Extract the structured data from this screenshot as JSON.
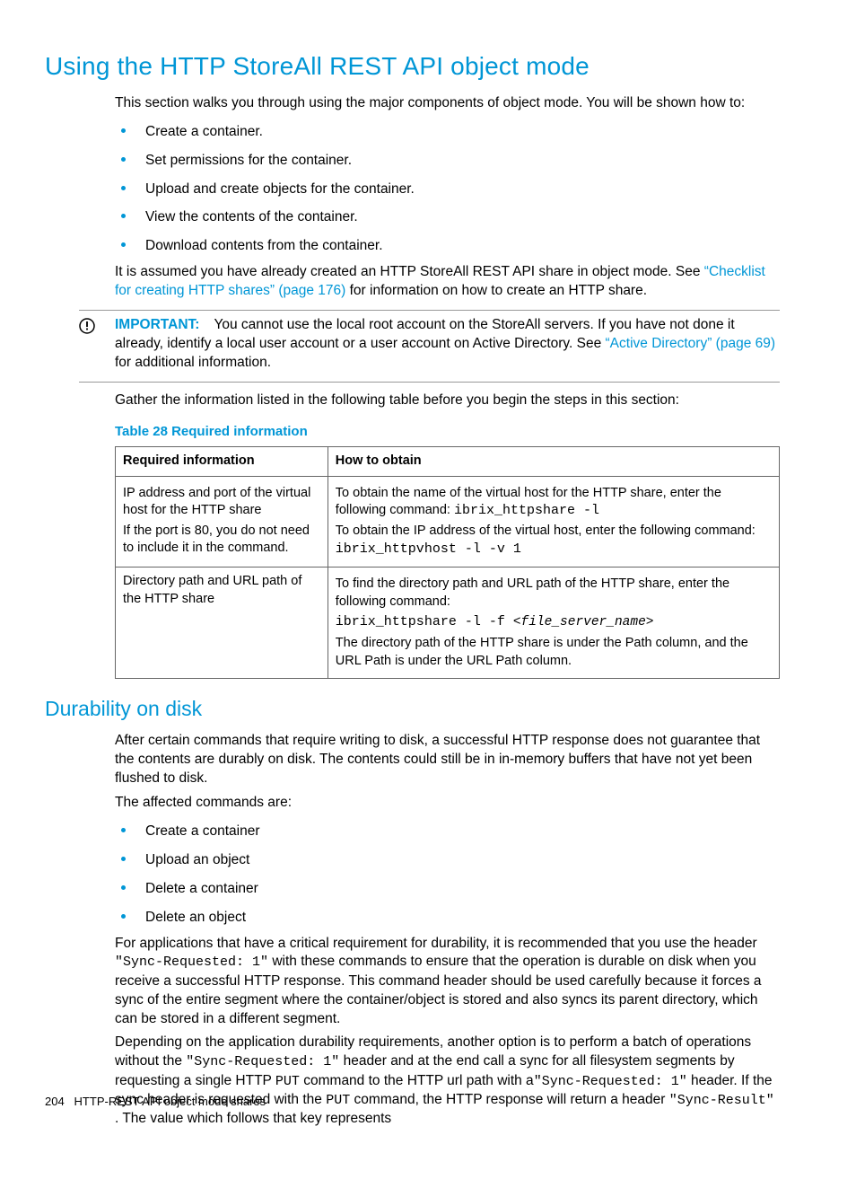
{
  "section1": {
    "heading": "Using the HTTP StoreAll REST API object mode",
    "intro": "This section walks you through using the major components of object mode. You will be shown how to:",
    "bullets": [
      "Create a container.",
      "Set permissions for the container.",
      "Upload and create objects for the container.",
      "View the contents of the container.",
      "Download contents from the container."
    ],
    "assumed_pre": "It is assumed you have already created an HTTP StoreAll REST API share in object mode. See ",
    "assumed_link": "“Checklist for creating HTTP shares” (page 176)",
    "assumed_post": " for information on how to create an HTTP share."
  },
  "important": {
    "label": "IMPORTANT:",
    "text_pre": "You cannot use the local root account on the StoreAll servers. If you have not done it already, identify a local user account or a user account on Active Directory. See ",
    "link": "“Active Directory” (page 69)",
    "text_post": " for additional information."
  },
  "gather_line": "Gather the information listed in the following table before you begin the steps in this section:",
  "table": {
    "caption": "Table 28 Required information",
    "headers": {
      "c1": "Required information",
      "c2": "How to obtain"
    },
    "rows": [
      {
        "c1_l1": "IP address and port of the virtual host for the HTTP share",
        "c1_l2": "If the port is 80, you do not need to include it in the command.",
        "c2_p1_pre": "To obtain the name of the virtual host for the HTTP share, enter the following command: ",
        "c2_p1_code": "ibrix_httpshare -l",
        "c2_p2": "To obtain the IP address of the virtual host, enter the following command:",
        "c2_p2_code": "ibrix_httpvhost -l -v 1"
      },
      {
        "c1": "Directory path and URL path of the HTTP share",
        "c2_p1": "To find the directory path and URL path of the HTTP share, enter the following command:",
        "c2_code_pre": "ibrix_httpshare -l -f ",
        "c2_code_arg": "<file_server_name>",
        "c2_p2": "The directory path of the HTTP share is under the Path column, and the URL Path is under the URL Path column."
      }
    ]
  },
  "section2": {
    "heading": "Durability on disk",
    "p1": "After certain commands that require writing to disk, a successful HTTP response does not guarantee that the contents are durably on disk. The contents could still be in in-memory buffers that have not yet been flushed to disk.",
    "p2": "The affected commands are:",
    "bullets": [
      "Create a container",
      "Upload an object",
      "Delete a container",
      "Delete an object"
    ],
    "p3_a": "For applications that have a critical requirement for durability, it is recommended that you use the header ",
    "p3_code1": "\"Sync-Requested: 1\"",
    "p3_b": " with these commands to ensure that the operation is durable on disk when you receive a successful HTTP response. This command header should be used carefully because it forces a sync of the entire segment where the container/object is stored and also syncs its parent directory, which can be stored in a different segment.",
    "p4_a": "Depending on the application durability requirements, another option is to perform a batch of operations without the ",
    "p4_code1": "\"Sync-Requested: 1\"",
    "p4_b": " header and at the end call a sync for all filesystem segments by requesting a single HTTP ",
    "p4_code2": "PUT",
    "p4_c": " command to the HTTP url path with a",
    "p4_code3": "\"Sync-Requested: 1\"",
    "p4_d": " header. If the sync header is requested with the ",
    "p4_code4": "PUT",
    "p4_e": " command, the HTTP response will return a header ",
    "p4_code5": "\"Sync-Result\"",
    "p4_f": " . The value which follows that key represents"
  },
  "footer": {
    "page": "204",
    "title": "HTTP-REST API object mode shares"
  }
}
